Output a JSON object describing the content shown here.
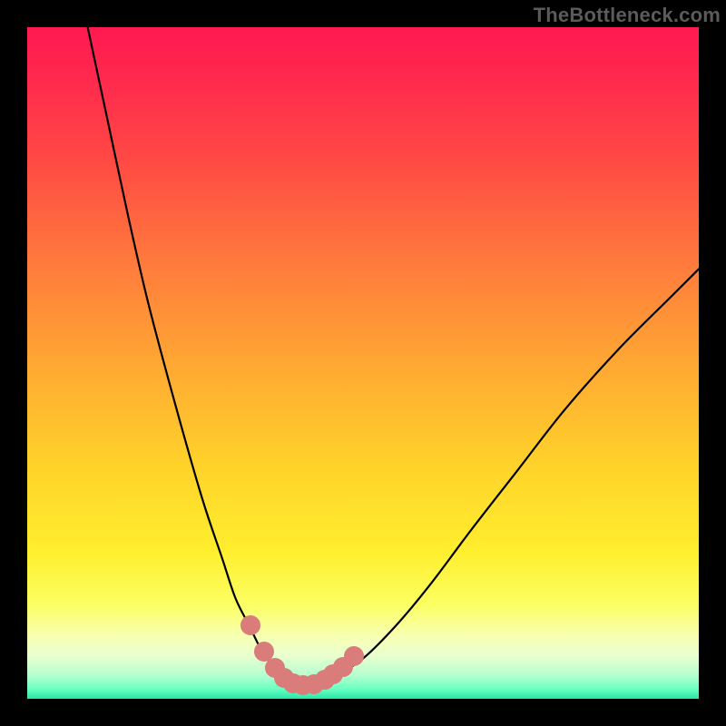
{
  "watermark": "TheBottleneck.com",
  "colors": {
    "background": "#000000",
    "curve": "#000000",
    "dots": "#d97c7a",
    "watermark": "#5b5b5b",
    "gradient_stops": [
      {
        "offset": 0.0,
        "color": "#ff1950"
      },
      {
        "offset": 0.08,
        "color": "#ff2a4d"
      },
      {
        "offset": 0.2,
        "color": "#ff4a44"
      },
      {
        "offset": 0.35,
        "color": "#ff7a3c"
      },
      {
        "offset": 0.5,
        "color": "#ffa733"
      },
      {
        "offset": 0.65,
        "color": "#ffd22a"
      },
      {
        "offset": 0.78,
        "color": "#ffee2e"
      },
      {
        "offset": 0.86,
        "color": "#fbff62"
      },
      {
        "offset": 0.905,
        "color": "#f8ffb0"
      },
      {
        "offset": 0.935,
        "color": "#eaffce"
      },
      {
        "offset": 0.965,
        "color": "#b6ffd0"
      },
      {
        "offset": 0.985,
        "color": "#6cffc2"
      },
      {
        "offset": 1.0,
        "color": "#27e6a8"
      }
    ]
  },
  "chart_data": {
    "type": "line",
    "title": "",
    "xlabel": "",
    "ylabel": "",
    "xlim": [
      0,
      100
    ],
    "ylim": [
      0,
      100
    ],
    "grid": false,
    "series": [
      {
        "name": "bottleneck-curve",
        "x": [
          9,
          12,
          15,
          18,
          22,
          26,
          29,
          31,
          33,
          35,
          36.5,
          38,
          39.5,
          41,
          43,
          46,
          50,
          55,
          60,
          66,
          73,
          80,
          88,
          96,
          100
        ],
        "y": [
          100,
          86,
          72,
          59,
          44,
          30,
          21,
          15,
          11,
          7,
          5,
          3.5,
          2.5,
          2,
          2.2,
          3.5,
          6,
          11,
          17,
          25,
          34,
          43,
          52,
          60,
          64
        ]
      }
    ],
    "markers": {
      "name": "highlight-dots",
      "x": [
        33.2,
        35.3,
        36.9,
        38.3,
        39.6,
        41.1,
        42.7,
        44.3,
        45.6,
        47.0,
        48.6
      ],
      "y": [
        11.0,
        7.0,
        4.6,
        3.1,
        2.3,
        2.0,
        2.2,
        2.8,
        3.6,
        4.7,
        6.4
      ]
    }
  }
}
